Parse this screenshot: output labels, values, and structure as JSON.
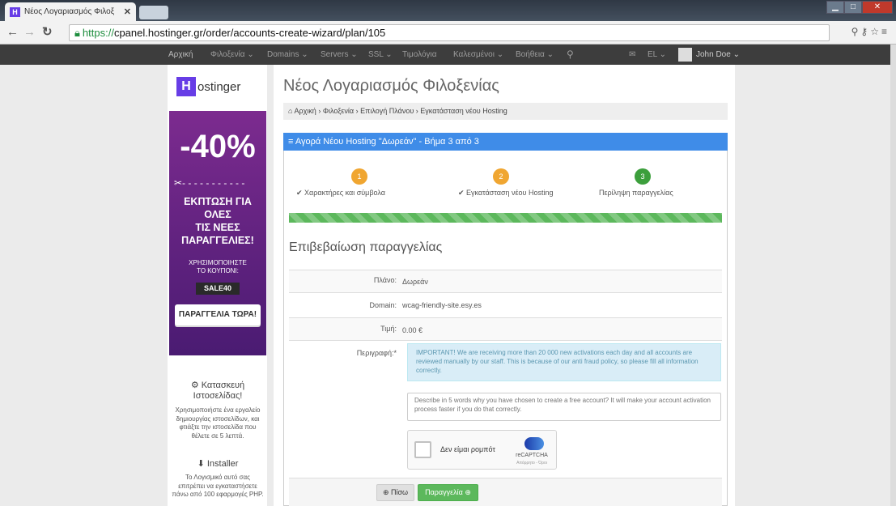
{
  "browser": {
    "tab_title": "Νέος Λογαριασμός Φιλοξ",
    "tab_close": "✕",
    "url_scheme": "https://",
    "url_rest": "cpanel.hostinger.gr/order/accounts-create-wizard/plan/105",
    "window": {
      "minimize": "▁",
      "maximize": "□",
      "close": "✕"
    }
  },
  "topnav": {
    "items": [
      "Αρχική",
      "Φιλοξενία ⌄",
      "Domains ⌄",
      "Servers ⌄",
      "SSL ⌄",
      "Τιμολόγια",
      "Καλεσμένοι ⌄",
      "Βοήθεια ⌄"
    ],
    "language": "EL ⌄",
    "user": "John Doe ⌄"
  },
  "sidebar": {
    "logo_mark": "H",
    "logo_text": "ostinger",
    "banner": {
      "percent": "-40%",
      "cut_line": "✂- - - - - - - - - - -",
      "headline_1": "ΕΚΠΤΩΣΗ ΓΙΑ",
      "headline_2": "ΟΛΕΣ",
      "headline_3": "ΤΙΣ ΝΕΕΣ",
      "headline_4": "ΠΑΡΑΓΓΕΛΙΕΣ!",
      "use_1": "ΧΡΗΣΙΜΟΠΟΙΗΣΤΕ",
      "use_2": "ΤΟ ΚΟΥΠΟΝΙ:",
      "coupon": "SALE40",
      "cta": "ΠΑΡΑΓΓΕΛΙΑ ΤΩΡΑ!"
    },
    "builder": {
      "title_1": "Κατασκευή",
      "title_2": "Ιστοσελίδας!",
      "text_1": "Χρησιμοποιήστε ένα εργαλείο",
      "text_2": "δημιουργίας ιστοσελίδων, και",
      "text_3": "φτιάξτε την ιστοσελίδα που",
      "text_4": "θέλετε σε 5 λεπτά."
    },
    "installer": {
      "title": "Installer",
      "text_1": "Το Λογισμικό αυτό σας",
      "text_2": "επιτρέπει να εγκαταστήσετε",
      "text_3": "πάνω από 100 εφαρμογές PHP."
    }
  },
  "main": {
    "page_title": "Νέος Λογαριασμός Φιλοξενίας",
    "breadcrumb": [
      "Αρχική",
      "Φιλοξενία",
      "Επιλογή Πλάνου",
      "Εγκατάσταση νέου Hosting"
    ],
    "breadcrumb_sep": "›",
    "panel_title": "Αγορά Νέου Hosting \"Δωρεάν\" - Βήμα 3 από 3",
    "steps": [
      {
        "num": "1",
        "label": "✔ Χαρακτήρες και σύμβολα"
      },
      {
        "num": "2",
        "label": "✔ Εγκατάσταση νέου Hosting"
      },
      {
        "num": "3",
        "label": "Περίληψη παραγγελίας"
      }
    ],
    "progress_percent": 100,
    "confirm_title": "Επιβεβαίωση παραγγελίας",
    "fields": {
      "plan_label": "Πλάνο:",
      "plan_value": "Δωρεάν",
      "domain_label": "Domain:",
      "domain_value": "wcag-friendly-site.esy.es",
      "price_label": "Τιμή:",
      "price_value": "0.00 €",
      "desc_label": "Περιγραφή:*"
    },
    "alert": "IMPORTANT! We are receiving more than 20 000 new activations each day and all accounts are reviewed manually by our staff. This is because of our anti fraud policy, so please fill all information correctly.",
    "textarea_placeholder": "Describe in 5 words why you have chosen to create a free account? It will make your account activation process faster if you do that correctly.",
    "captcha": {
      "label": "Δεν είμαι ρομπότ",
      "brand": "reCAPTCHA",
      "terms": "Απόρρητο - Όροι"
    },
    "back_button": "⊕ Πίσω",
    "order_button": "Παραγγελία ⊕"
  },
  "colors": {
    "accent": "#3f8ce8",
    "success": "#5cb85c",
    "step_done": "#f0a631",
    "step_current": "#3c9f3c"
  }
}
